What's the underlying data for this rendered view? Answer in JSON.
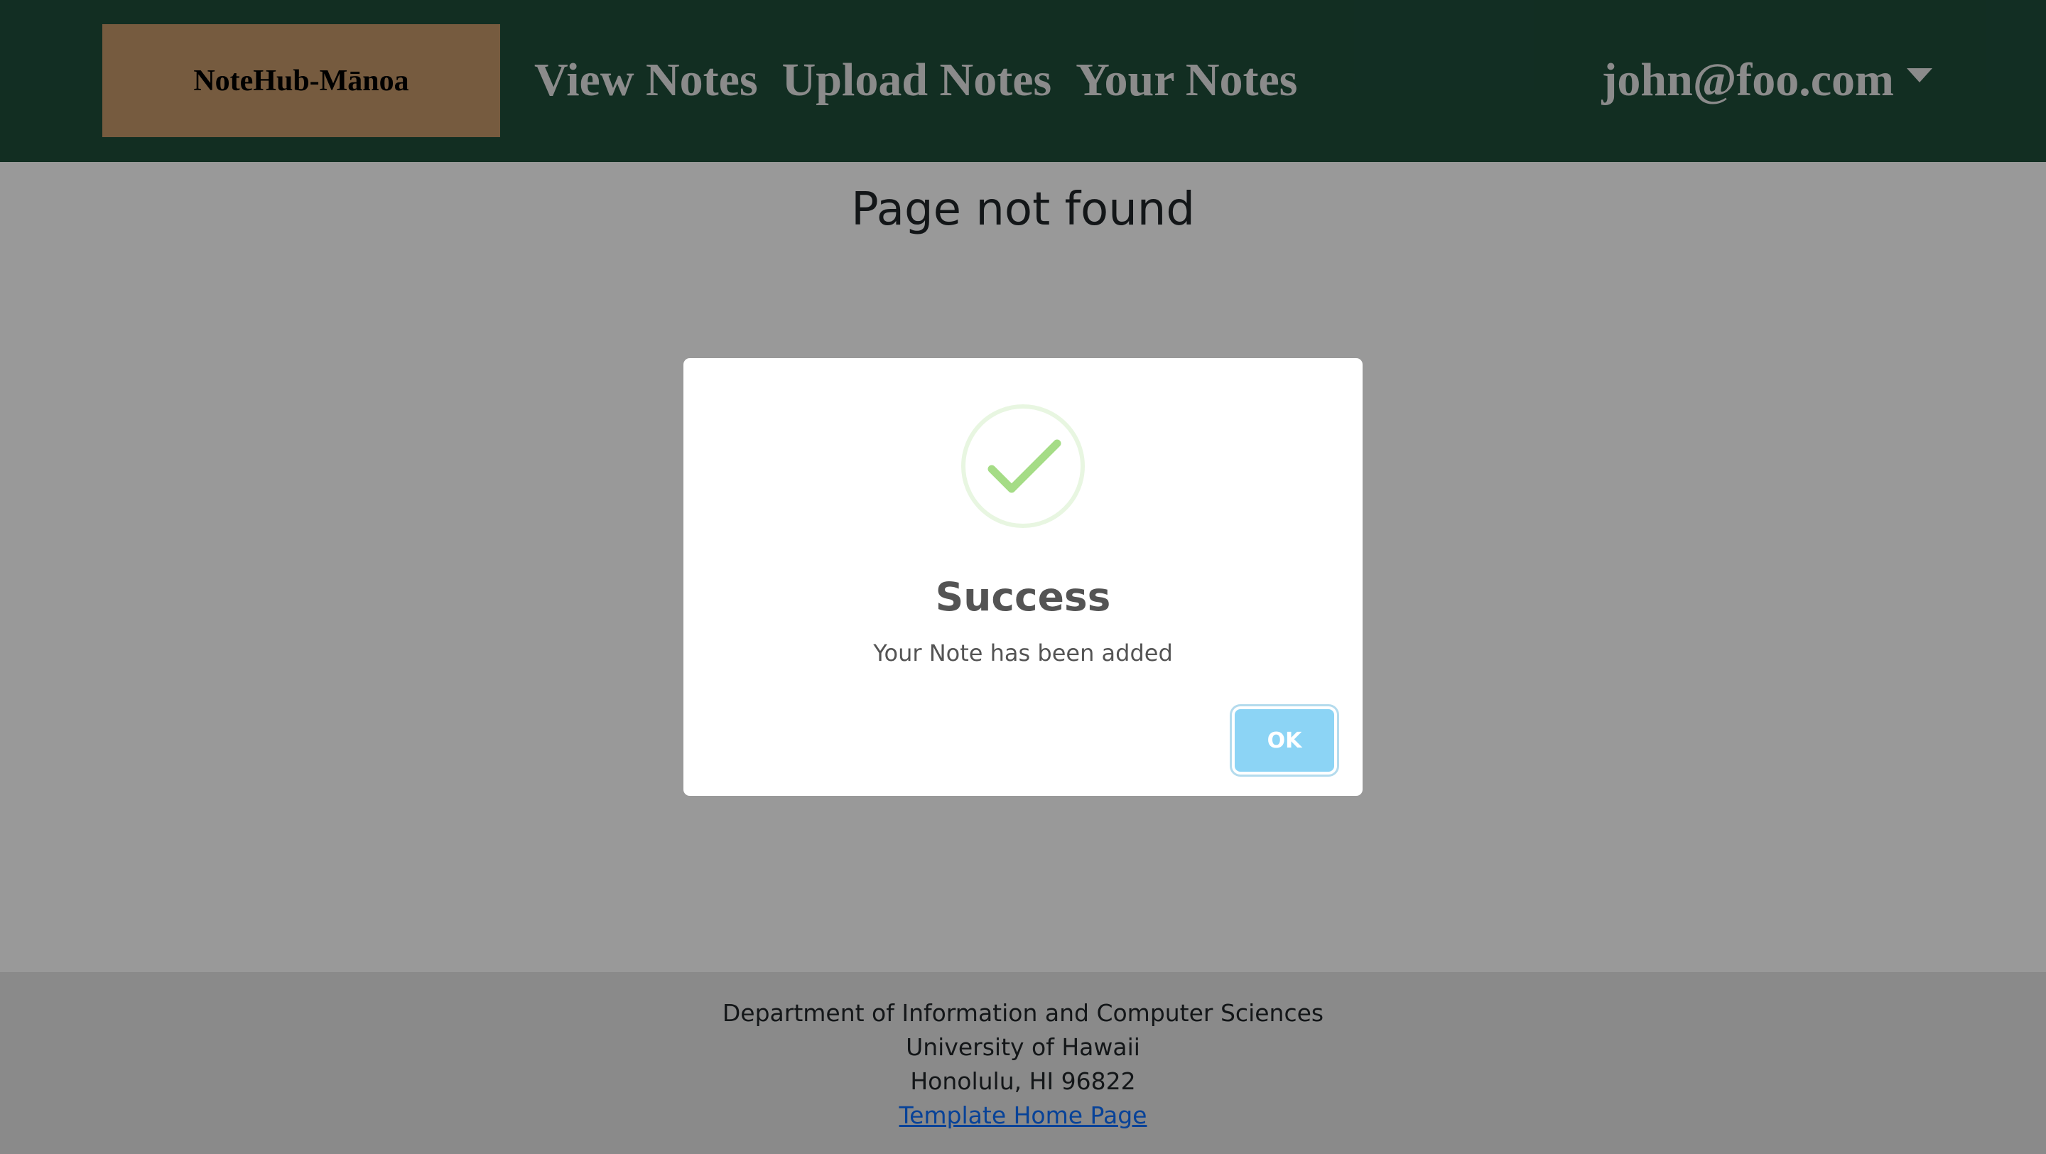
{
  "navbar": {
    "brand": "NoteHub-Mānoa",
    "links": [
      {
        "label": "View Notes"
      },
      {
        "label": "Upload Notes"
      },
      {
        "label": "Your Notes"
      }
    ],
    "user": "john@foo.com",
    "user_icon": "caret-down-icon"
  },
  "main": {
    "title": "Page not found"
  },
  "footer": {
    "line1": "Department of Information and Computer Sciences",
    "line2": "University of Hawaii",
    "line3": "Honolulu, HI 96822",
    "link": "Template Home Page"
  },
  "modal": {
    "icon": "checkmark-icon",
    "title": "Success",
    "text": "Your Note has been added",
    "button": "OK"
  },
  "colors": {
    "navbar_bg": "#1e4d3a",
    "brand_bg": "#c5986a",
    "success_green": "#a5dc86",
    "button_blue": "#8cd4f5",
    "footer_bg": "#e6e6e6",
    "link_blue": "#0d6efd"
  }
}
